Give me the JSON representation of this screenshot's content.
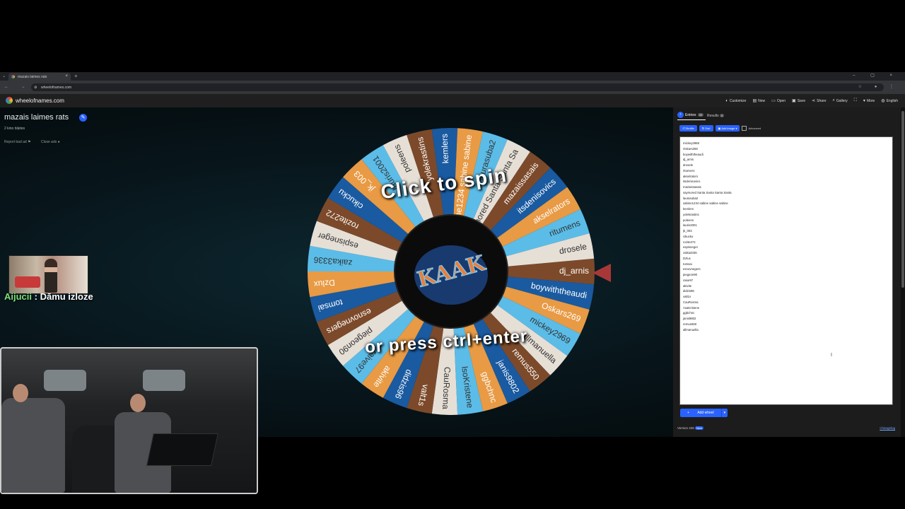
{
  "browser": {
    "tab_title": "mazais laimes rats",
    "tab_close": "×",
    "new_tab": "+",
    "tab_menu": "⌄",
    "window_controls": "– ▢ ×",
    "nav_buttons": "← → ⟳",
    "url": "wheelofnames.com",
    "url_icon": "⚙",
    "extension_icons": "☆ ● ⋮"
  },
  "site": {
    "name": "wheelofnames.com",
    "menu": [
      {
        "icon": "palette-icon",
        "glyph": "◐",
        "label": "Customize"
      },
      {
        "icon": "new-icon",
        "glyph": "▤",
        "label": "New"
      },
      {
        "icon": "folder-icon",
        "glyph": "▭",
        "label": "Open"
      },
      {
        "icon": "save-icon",
        "glyph": "▣",
        "label": "Save"
      },
      {
        "icon": "share-icon",
        "glyph": "⋖",
        "label": "Share"
      },
      {
        "icon": "search-icon",
        "glyph": "⌕",
        "label": "Gallery"
      },
      {
        "icon": "fullscreen-icon",
        "glyph": "⛶",
        "label": ""
      },
      {
        "icon": "chevron-down-icon",
        "glyph": "▾",
        "label": "More"
      },
      {
        "icon": "globe-icon",
        "glyph": "◍",
        "label": "English"
      }
    ]
  },
  "page": {
    "title": "mazais laimes rats",
    "edit_glyph": "✎",
    "subtitle": "2 kino biļetes",
    "report": "Report bad ad",
    "report_glyph": "⚑",
    "close_ads": "Close ads",
    "close_ads_glyph": "●"
  },
  "wheel": {
    "prompt_top": "Click to spin",
    "prompt_bottom": "or press ctrl+enter",
    "center_logo_text": "KAAK",
    "segment_colors": [
      "#7c4a2a",
      "#1a5aa0",
      "#e89a44",
      "#5bbce8",
      "#e6dfd6"
    ],
    "segments": [
      "dj_arnis",
      "boywiththeaudi",
      "Oskars269",
      "mickey2969",
      "allmanuella",
      "remus550",
      "janis9802",
      "ggbchnc",
      "lsoKristene",
      "CauRosma",
      "valt1s",
      "didzis96",
      "akivite",
      "raive97",
      "piegeon90",
      "esnovnegers",
      "tomsai",
      "Dzlux",
      "zaika3336",
      "espisneger",
      "rozite272",
      "cikucku",
      "jk_003",
      "lauris2001",
      "poleens",
      "yolekrastins",
      "kemlers",
      "sabine1234 sabine sabine",
      "laurasuba2",
      "saymored Santa Santa Sa",
      "mazaissasais",
      "itsdenisovics",
      "akselrators",
      "ritumens",
      "drosele"
    ]
  },
  "panel": {
    "tab_entries": "Entries",
    "entries_count": "39",
    "tab_results": "Results",
    "results_count": "0",
    "chevron_glyph": "›",
    "buttons": [
      {
        "glyph": "⤮",
        "label": "Shuffle"
      },
      {
        "glyph": "⇅",
        "label": "Sort"
      },
      {
        "glyph": "▣",
        "label": "Add image ▾"
      }
    ],
    "advanced_label": "Advanced",
    "entries": [
      "mickey2969",
      "Oskars269",
      "boywiththeaudi",
      "dj_arnis",
      "drosele",
      "ritumens",
      "akselrators",
      "itsdenisovics",
      "mazaissasais",
      "saymored Santa Santa Santa Santa",
      "laurasuba2",
      "sabine1234 sabine sabine sabine",
      "kemlers",
      "yolekrastins",
      "poleens",
      "lauris2001",
      "jk_003",
      "cikucku",
      "rozite272",
      "espisneger",
      "zaika3336",
      "Dzlux",
      "tomsai",
      "esnovnegers",
      "piegeon90",
      "raive97",
      "akivite",
      "didzis96",
      "valt1s",
      "CauRosma",
      "AsaKristene",
      "ggbchnc",
      "janis9802",
      "remus550",
      "allmanuella"
    ],
    "cursor_glyph": "I",
    "add_wheel": "Add wheel",
    "add_wheel_glyph": "+",
    "add_wheel_caret": "▾",
    "version": "Version 425",
    "new_badge": "New",
    "changelog": "Changelog"
  },
  "overlay": {
    "chat_user": "Aijucii",
    "chat_sep": " : ",
    "chat_message": "Dāmu izloze"
  }
}
